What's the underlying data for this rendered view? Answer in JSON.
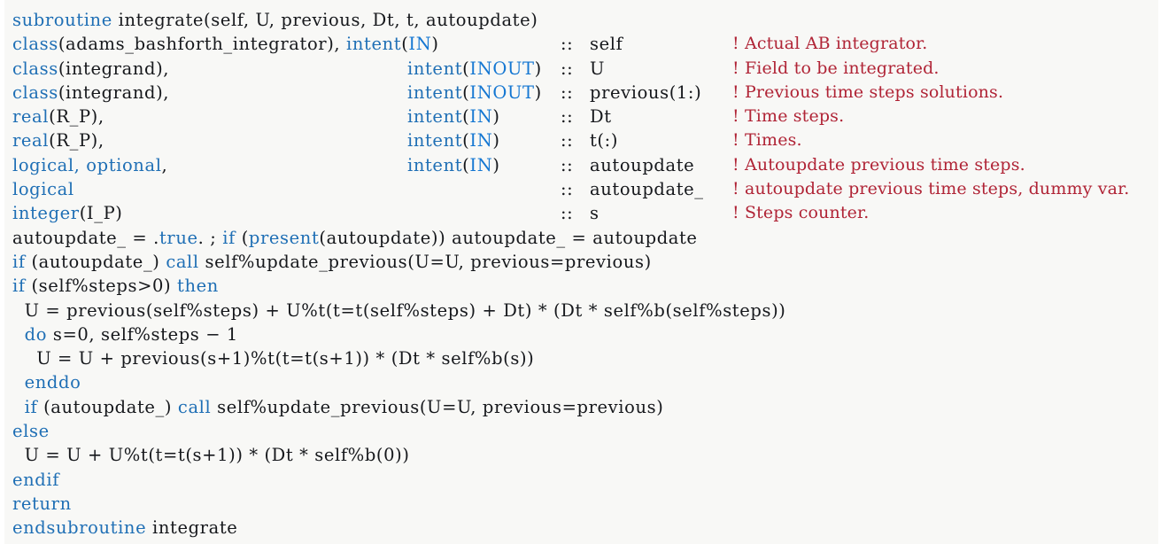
{
  "document": {
    "kind": "fortran-code-listing",
    "language": "Fortran",
    "routine_name": "integrate",
    "background_color": "#f8f8f6",
    "keyword_color": "#1f6fb5",
    "intent_value_color": "#1577d2",
    "comment_color": "#b02436",
    "text_color": "#16181c"
  },
  "lines": [
    {
      "id": 1,
      "kw": "subroutine",
      "code": " integrate(self, U, previous, Dt, t, autoupdate)",
      "sep": "",
      "name": "",
      "comment": ""
    },
    {
      "id": 2,
      "kw": "class",
      "code": "(adams_bashforth_integrator), ",
      "kw_intent": "intent",
      "intent_open": "(",
      "intent_value": "IN",
      "intent_close": ")",
      "sep": "::",
      "name": "self",
      "comment": "! Actual AB integrator."
    },
    {
      "id": 3,
      "kw": "class",
      "code": "(integrand),",
      "kw_intent": "intent",
      "intent_open": "(",
      "intent_value": "INOUT",
      "intent_close": ")",
      "sep": "::",
      "name": "U",
      "comment": "! Field to be integrated."
    },
    {
      "id": 4,
      "kw": "class",
      "code": "(integrand),",
      "kw_intent": "intent",
      "intent_open": "(",
      "intent_value": "INOUT",
      "intent_close": ")",
      "sep": "::",
      "name": "previous(1:)",
      "comment": "! Previous time steps solutions."
    },
    {
      "id": 5,
      "kw": "real",
      "code": "(R_P),",
      "kw_intent": "intent",
      "intent_open": "(",
      "intent_value": "IN",
      "intent_close": ")",
      "sep": "::",
      "name": "Dt",
      "comment": "! Time steps."
    },
    {
      "id": 6,
      "kw": "real",
      "code": "(R_P),",
      "kw_intent": "intent",
      "intent_open": "(",
      "intent_value": "IN",
      "intent_close": ")",
      "sep": "::",
      "name": "t(:)",
      "comment": "! Times."
    },
    {
      "id": 7,
      "kw": "logical, optional",
      "code": ",",
      "kw_intent": "intent",
      "intent_open": "(",
      "intent_value": "IN",
      "intent_close": ")",
      "sep": "::",
      "name": "autoupdate",
      "comment": "! Autoupdate previous time steps."
    },
    {
      "id": 8,
      "kw": "logical",
      "code": "",
      "kw_intent": "",
      "intent_open": "",
      "intent_value": "",
      "intent_close": "",
      "sep": "::",
      "name": "autoupdate_",
      "comment": "! autoupdate previous time steps, dummy var."
    },
    {
      "id": 9,
      "kw": "integer",
      "code": "(I_P)",
      "kw_intent": "",
      "intent_open": "",
      "intent_value": "",
      "intent_close": "",
      "sep": "::",
      "name": "s",
      "comment": "! Steps counter."
    }
  ],
  "body": {
    "line10": {
      "a": "autoupdate_ = .",
      "kw1": "true",
      "b": ". ; ",
      "kw2": "if",
      "c": " (",
      "kw3": "present",
      "d": "(autoupdate)) autoupdate_ = autoupdate"
    },
    "line11": {
      "kw1": "if",
      "a": " (autoupdate_) ",
      "kw2": "call",
      "b": " self%update_previous(U=U, previous=previous)"
    },
    "line12": {
      "kw1": "if",
      "a": " (self%steps>0) ",
      "kw2": "then"
    },
    "line13": {
      "a": "  U = previous(self%steps) + U%t(t=t(self%steps) + Dt) * (Dt * self%b(self%steps))"
    },
    "line14": {
      "indent": "  ",
      "kw1": "do",
      "a": " s=0, self%steps − 1"
    },
    "line15": {
      "a": "    U = U + previous(s+1)%t(t=t(s+1)) * (Dt * self%b(s))"
    },
    "line16": {
      "indent": "  ",
      "kw1": "enddo"
    },
    "line17": {
      "indent": "  ",
      "kw1": "if",
      "a": " (autoupdate_) ",
      "kw2": "call",
      "b": " self%update_previous(U=U, previous=previous)"
    },
    "line18": {
      "kw1": "else"
    },
    "line19": {
      "a": "  U = U + U%t(t=t(s+1)) * (Dt * self%b(0))"
    },
    "line20": {
      "kw1": "endif"
    },
    "line21": {
      "kw1": "return"
    },
    "line22": {
      "kw1": "endsubroutine",
      "a": " integrate"
    }
  }
}
